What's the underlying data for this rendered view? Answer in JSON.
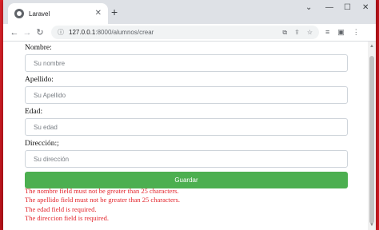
{
  "browser": {
    "tab_title": "Laravel",
    "tab_close": "✕",
    "new_tab": "+",
    "url_host": "127.0.0.1",
    "url_path": ":8000/alumnos/crear",
    "controls": {
      "collapse": "⌄",
      "minimize": "—",
      "maximize": "☐",
      "close": "✕"
    },
    "nav": {
      "back": "←",
      "forward": "→",
      "reload": "↻"
    },
    "omnibox_icons": {
      "translate": "⧉",
      "share": "⇪",
      "bookmark": "☆"
    },
    "toolbar_icons": {
      "reading_list": "≡",
      "side_panel": "▣",
      "menu": "⋮"
    },
    "site_info_icon": "ⓘ"
  },
  "form": {
    "fields": [
      {
        "label": "Nombre:",
        "placeholder": "Su nombre"
      },
      {
        "label": "Apellido:",
        "placeholder": "Su Apellido"
      },
      {
        "label": "Edad:",
        "placeholder": "Su edad"
      },
      {
        "label": "Dirección:;",
        "placeholder": "Su dirección"
      }
    ],
    "submit_label": "Guardar"
  },
  "errors": [
    "The nombre field must not be greater than 25 characters.",
    "The apellido field must not be greater than 25 characters.",
    "The edad field is required.",
    "The direccion field is required."
  ],
  "colors": {
    "button": "#4caf50",
    "error": "#e3262d",
    "desktop": "#c8141c"
  }
}
